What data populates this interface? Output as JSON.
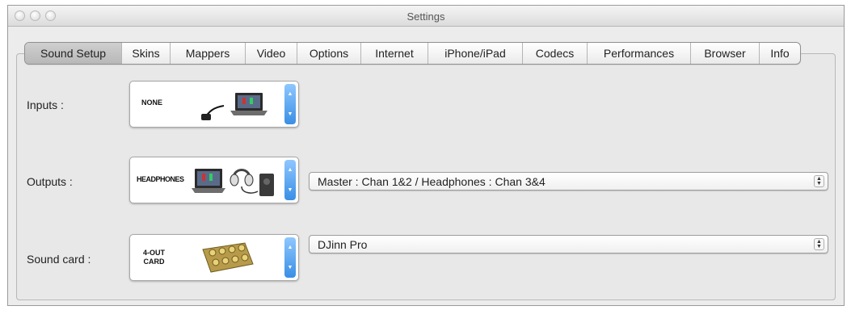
{
  "window": {
    "title": "Settings"
  },
  "tabs": [
    {
      "label": "Sound Setup",
      "active": true
    },
    {
      "label": "Skins",
      "active": false
    },
    {
      "label": "Mappers",
      "active": false
    },
    {
      "label": "Video",
      "active": false
    },
    {
      "label": "Options",
      "active": false
    },
    {
      "label": "Internet",
      "active": false
    },
    {
      "label": "iPhone/iPad",
      "active": false
    },
    {
      "label": "Codecs",
      "active": false
    },
    {
      "label": "Performances",
      "active": false
    },
    {
      "label": "Browser",
      "active": false
    },
    {
      "label": "Info",
      "active": false
    }
  ],
  "inputs": {
    "label": "Inputs :",
    "selection": "NONE",
    "icon": "laptop-cable-icon"
  },
  "outputs": {
    "label": "Outputs :",
    "selection": "HEADPHONES",
    "icon": "laptop-headphones-speaker-icon",
    "routing": "Master : Chan 1&2 / Headphones : Chan 3&4"
  },
  "sound_card": {
    "label": "Sound card :",
    "selection_line1": "4-OUT",
    "selection_line2": "CARD",
    "icon": "sound-card-connector-icon",
    "device": "DJinn Pro"
  },
  "colors": {
    "stepper_blue": "#3a8fe5",
    "window_bg": "#ececec"
  }
}
